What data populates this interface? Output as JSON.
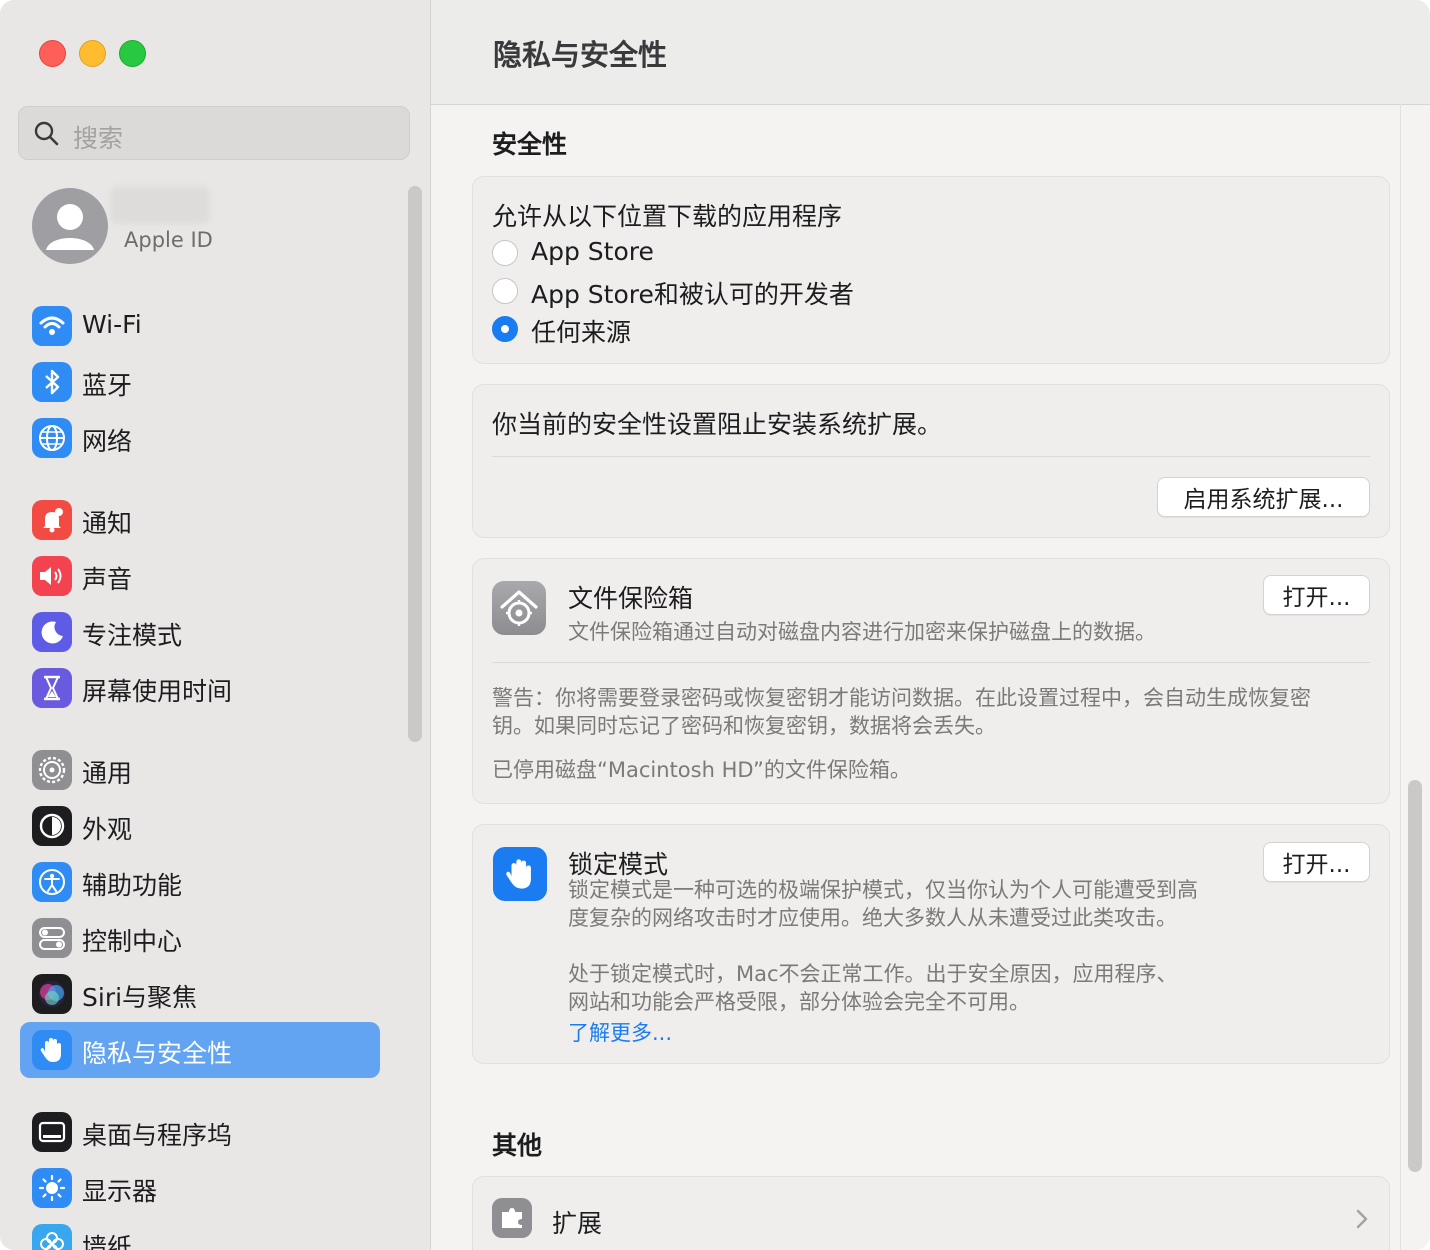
{
  "window": {
    "title": "隐私与安全性"
  },
  "sidebar": {
    "search_placeholder": "搜索",
    "account": {
      "subtitle": "Apple ID"
    },
    "items": [
      {
        "label": "Wi-Fi",
        "icon": "wifi-icon",
        "color": "#2f8cf5"
      },
      {
        "label": "蓝牙",
        "icon": "bluetooth-icon",
        "color": "#2f8cf5"
      },
      {
        "label": "网络",
        "icon": "globe-icon",
        "color": "#2f8cf5"
      },
      {
        "label": "通知",
        "icon": "bell-icon",
        "color": "#f24b43"
      },
      {
        "label": "声音",
        "icon": "speaker-icon",
        "color": "#f2434f"
      },
      {
        "label": "专注模式",
        "icon": "moon-icon",
        "color": "#5e5ce6"
      },
      {
        "label": "屏幕使用时间",
        "icon": "hourglass-icon",
        "color": "#6a5ae0"
      },
      {
        "label": "通用",
        "icon": "gear-icon",
        "color": "#8e8e93"
      },
      {
        "label": "外观",
        "icon": "appearance-icon",
        "color": "#1d1d1f"
      },
      {
        "label": "辅助功能",
        "icon": "accessibility-icon",
        "color": "#2f8cf5"
      },
      {
        "label": "控制中心",
        "icon": "toggles-icon",
        "color": "#8e8e93"
      },
      {
        "label": "Siri与聚焦",
        "icon": "siri-icon",
        "color": "#1d1d1f"
      },
      {
        "label": "隐私与安全性",
        "icon": "hand-icon",
        "color": "#2f8cf5",
        "selected": true
      },
      {
        "label": "桌面与程序坞",
        "icon": "dock-icon",
        "color": "#1d1d1f"
      },
      {
        "label": "显示器",
        "icon": "sun-icon",
        "color": "#2f8cf5"
      },
      {
        "label": "墙纸",
        "icon": "flower-icon",
        "color": "#39a7f0"
      }
    ]
  },
  "main": {
    "security_section": "安全性",
    "downloads": {
      "title": "允许从以下位置下载的应用程序",
      "options": [
        {
          "label": "App Store",
          "selected": false
        },
        {
          "label": "App Store和被认可的开发者",
          "selected": false
        },
        {
          "label": "任何来源",
          "selected": true
        }
      ]
    },
    "extensions_block": {
      "text": "你当前的安全性设置阻止安装系统扩展。",
      "button": "启用系统扩展..."
    },
    "filevault": {
      "title": "文件保险箱",
      "description": "文件保险箱通过自动对磁盘内容进行加密来保护磁盘上的数据。",
      "button": "打开...",
      "warning_line1": "警告：你将需要登录密码或恢复密钥才能访问数据。在此设置过程中，会自动生成恢复密",
      "warning_line2": "钥。如果同时忘记了密码和恢复密钥，数据将会丢失。",
      "status": "已停用磁盘“Macintosh HD”的文件保险箱。"
    },
    "lockdown": {
      "title": "锁定模式",
      "button": "打开...",
      "desc_line1": "锁定模式是一种可选的极端保护模式，仅当你认为个人可能遭受到高",
      "desc_line2": "度复杂的网络攻击时才应使用。绝大多数人从未遭受过此类攻击。",
      "desc_line3": "处于锁定模式时，Mac不会正常工作。出于安全原因，应用程序、",
      "desc_line4": "网站和功能会严格受限，部分体验会完全不可用。",
      "link": "了解更多..."
    },
    "other_section": "其他",
    "other_items": [
      {
        "label": "扩展",
        "icon": "extensions-icon"
      }
    ]
  }
}
